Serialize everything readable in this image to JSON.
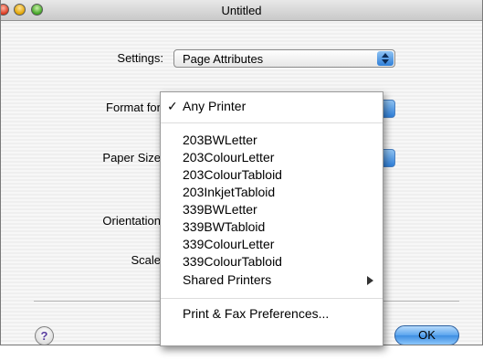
{
  "window": {
    "title": "Untitled"
  },
  "settings": {
    "label": "Settings:",
    "selected": "Page Attributes"
  },
  "format_for": {
    "label": "Format for"
  },
  "paper_size": {
    "label": "Paper Size"
  },
  "orientation": {
    "label": "Orientation"
  },
  "scale": {
    "label": "Scale"
  },
  "printer_menu": {
    "checked_item": "Any Printer",
    "printers": [
      "203BWLetter",
      "203ColourLetter",
      "203ColourTabloid",
      "203InkjetTabloid",
      "339BWLetter",
      "339BWTabloid",
      "339ColourLetter",
      "339ColourTabloid"
    ],
    "shared_printers": "Shared Printers",
    "preferences": "Print & Fax Preferences..."
  },
  "buttons": {
    "help": "?",
    "ok": "OK"
  },
  "colors": {
    "accent": "#3e8ee2",
    "menu_bg": "#ffffff"
  },
  "icons": [
    "checkmark-icon",
    "submenu-arrow-icon",
    "popup-arrows-icon",
    "help-icon"
  ]
}
